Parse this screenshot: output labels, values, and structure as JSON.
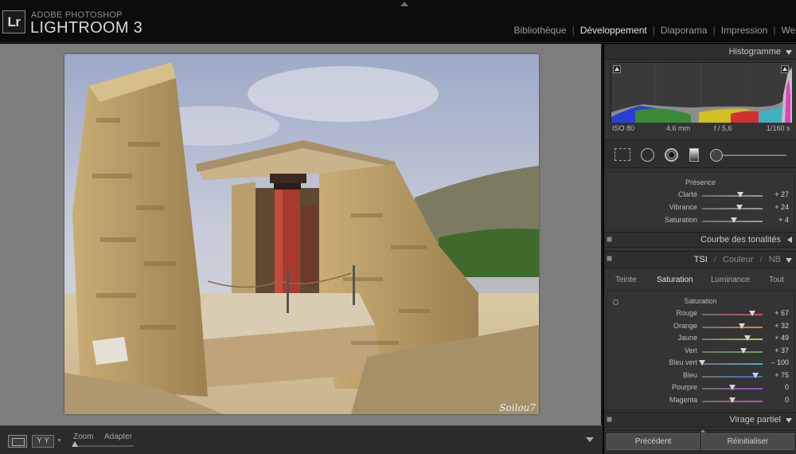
{
  "app": {
    "logo": "Lr",
    "brand_top": "ADOBE PHOTOSHOP",
    "brand_main": "LIGHTROOM 3"
  },
  "modules": [
    {
      "label": "Bibliothèque",
      "active": false
    },
    {
      "label": "Développement",
      "active": true
    },
    {
      "label": "Diaporama",
      "active": false
    },
    {
      "label": "Impression",
      "active": false
    },
    {
      "label": "Web",
      "active": false
    }
  ],
  "photo": {
    "watermark": "Soilou7"
  },
  "toolbar": {
    "zoom_label": "Zoom",
    "zoom_value": "Adapter",
    "yy_label": "Y Y"
  },
  "panel": {
    "histogram": {
      "title": "Histogramme",
      "iso": "ISO 80",
      "focal": "4.6 mm",
      "aperture": "f / 5,6",
      "shutter": "1/160 s"
    },
    "presence": {
      "title": "Présence",
      "sliders": [
        {
          "label": "Clarté",
          "value": "+ 27",
          "amount": 27
        },
        {
          "label": "Vibrance",
          "value": "+ 24",
          "amount": 24
        },
        {
          "label": "Saturation",
          "value": "+ 4",
          "amount": 4
        }
      ]
    },
    "tone_curve": {
      "title": "Courbe des tonalités"
    },
    "hsl": {
      "title_tsi": "TSI",
      "title_couleur": "Couleur",
      "title_nb": "NB",
      "tabs": [
        {
          "label": "Teinte",
          "active": false
        },
        {
          "label": "Saturation",
          "active": true
        },
        {
          "label": "Luminance",
          "active": false
        },
        {
          "label": "Tout",
          "active": false
        }
      ],
      "group_title": "Saturation",
      "sliders": [
        {
          "label": "Rouge",
          "value": "+ 67",
          "amount": 67,
          "color": "#c85050"
        },
        {
          "label": "Orange",
          "value": "+ 32",
          "amount": 32,
          "color": "#d08a3c"
        },
        {
          "label": "Jaune",
          "value": "+ 49",
          "amount": 49,
          "color": "#d0c040"
        },
        {
          "label": "Vert",
          "value": "+ 37",
          "amount": 37,
          "color": "#58b048"
        },
        {
          "label": "Bleu vert",
          "value": "– 100",
          "amount": -100,
          "color": "#4ab4b4"
        },
        {
          "label": "Bleu",
          "value": "+ 75",
          "amount": 75,
          "color": "#4a6ad0"
        },
        {
          "label": "Pourpre",
          "value": "0",
          "amount": 0,
          "color": "#9a50c8"
        },
        {
          "label": "Magenta",
          "value": "0",
          "amount": 0,
          "color": "#c850a8"
        }
      ]
    },
    "split_toning": {
      "title": "Virage partiel"
    },
    "buttons": {
      "previous": "Précédent",
      "reset": "Réinitialiser"
    }
  },
  "colors": {
    "canvas_bg": "#7d7d7d",
    "panel_bg": "#333333",
    "topbar_bg": "#0b0b0b"
  }
}
